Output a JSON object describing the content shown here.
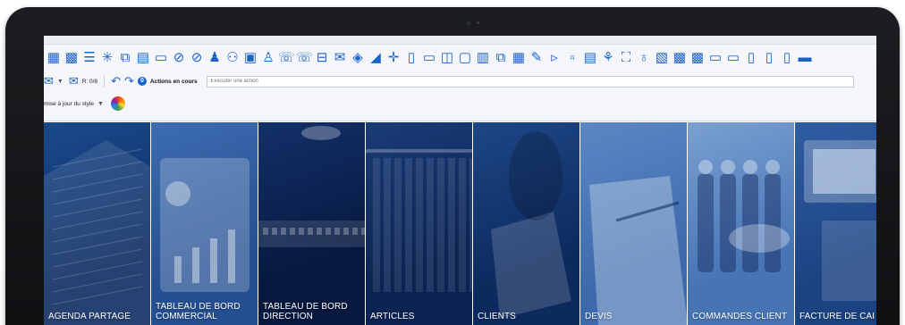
{
  "ribbon": {
    "action_counter": "R: 0/8",
    "actions_badge": "0",
    "actions_label": "Actions en cours",
    "action_placeholder": "Exécuter une action",
    "style_update_label": "mise à jour du style",
    "icons": [
      "table-icon",
      "grid-icon",
      "list-icon",
      "sparkle-icon",
      "chart-icon",
      "building-icon",
      "folder-icon",
      "tag-icon",
      "tag-icon",
      "users-icon",
      "network-icon",
      "calculator-icon",
      "person-icon",
      "phone-icon",
      "phone-icon",
      "briefcase-icon",
      "mail-icon",
      "cube-icon",
      "bar-chart-icon",
      "move-icon",
      "document-icon",
      "folder-icon",
      "binoculars-icon",
      "page-icon",
      "report-icon",
      "chart-icon",
      "table-icon",
      "wrench-icon",
      "play-icon",
      "square-icon",
      "invoice-icon",
      "tree-icon",
      "flow-icon",
      "lightbulb-icon",
      "clipboard-icon",
      "grid-icon",
      "grid-icon",
      "folder-icon",
      "folder-icon",
      "document-icon",
      "document-icon",
      "document-icon",
      "truck-icon"
    ]
  },
  "tiles": [
    {
      "label": "AGENDA PARTAGE",
      "bg1": "#0e2d62",
      "bg2": "#1a4a8c"
    },
    {
      "label": "TABLEAU DE BORD\nCOMMERCIAL",
      "bg1": "#244f91",
      "bg2": "#3d6cb0"
    },
    {
      "label": "TABLEAU DE BORD\nDIRECTION",
      "bg1": "#06183e",
      "bg2": "#13306a"
    },
    {
      "label": "ARTICLES",
      "bg1": "#0b2352",
      "bg2": "#1a3c78"
    },
    {
      "label": "CLIENTS",
      "bg1": "#0d2a5e",
      "bg2": "#1d4686"
    },
    {
      "label": "DEVIS",
      "bg1": "#3c6aad",
      "bg2": "#5b87c4"
    },
    {
      "label": "COMMANDES CLIENT",
      "bg1": "#4774b5",
      "bg2": "#7aa0d2"
    },
    {
      "label": "FACTURE DE CAI",
      "bg1": "#1b4382",
      "bg2": "#2f5ea2"
    }
  ]
}
